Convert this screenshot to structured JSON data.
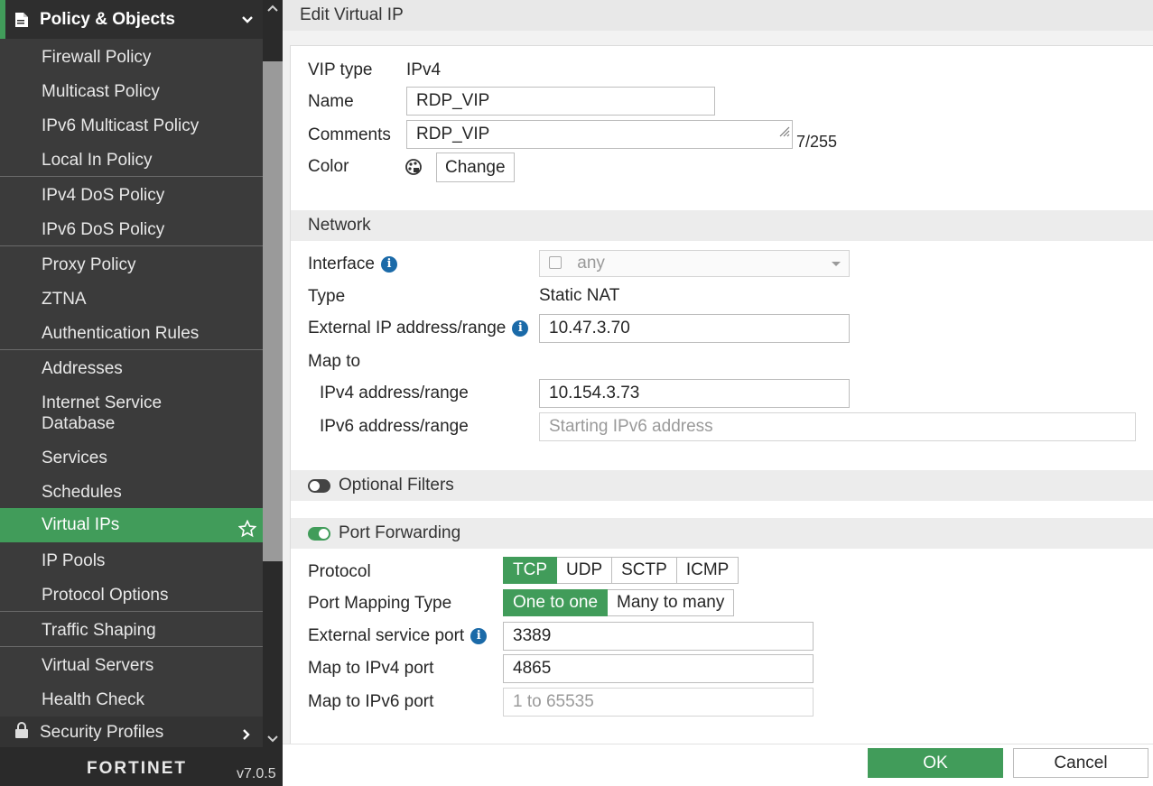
{
  "sidebar": {
    "section_title": "Policy & Objects",
    "items": [
      {
        "label": "Firewall Policy"
      },
      {
        "label": "Multicast Policy"
      },
      {
        "label": "IPv6 Multicast Policy"
      },
      {
        "label": "Local In Policy"
      },
      {
        "label": "IPv4 DoS Policy"
      },
      {
        "label": "IPv6 DoS Policy"
      },
      {
        "label": "Proxy Policy"
      },
      {
        "label": "ZTNA"
      },
      {
        "label": "Authentication Rules"
      },
      {
        "label": "Addresses"
      },
      {
        "label": "Internet Service\nDatabase"
      },
      {
        "label": "Services"
      },
      {
        "label": "Schedules"
      },
      {
        "label": "Virtual IPs"
      },
      {
        "label": "IP Pools"
      },
      {
        "label": "Protocol Options"
      },
      {
        "label": "Traffic Shaping"
      },
      {
        "label": "Virtual Servers"
      },
      {
        "label": "Health Check"
      }
    ],
    "active_item": "Virtual IPs",
    "next_section": "Security Profiles",
    "logo_text": "FORTINET",
    "version": "v7.0.5"
  },
  "page": {
    "title": "Edit Virtual IP"
  },
  "form": {
    "vip_type_label": "VIP type",
    "vip_type_value": "IPv4",
    "name_label": "Name",
    "name_value": "RDP_VIP",
    "comments_label": "Comments",
    "comments_value": "RDP_VIP",
    "comments_counter": "7/255",
    "color_label": "Color",
    "change_label": "Change"
  },
  "network": {
    "heading": "Network",
    "interface_label": "Interface",
    "interface_value": "any",
    "type_label": "Type",
    "type_value": "Static NAT",
    "external_ip_label": "External IP address/range",
    "external_ip_value": "10.47.3.70",
    "map_to_label": "Map to",
    "ipv4_label": "IPv4 address/range",
    "ipv4_value": "10.154.3.73",
    "ipv6_label": "IPv6 address/range",
    "ipv6_placeholder": "Starting IPv6 address"
  },
  "optional_filters": {
    "label": "Optional Filters",
    "enabled": false
  },
  "port_forwarding": {
    "label": "Port Forwarding",
    "enabled": true,
    "protocol_label": "Protocol",
    "protocols": [
      "TCP",
      "UDP",
      "SCTP",
      "ICMP"
    ],
    "protocol_selected": "TCP",
    "mapping_type_label": "Port Mapping Type",
    "mapping_types": [
      "One to one",
      "Many to many"
    ],
    "mapping_selected": "One to one",
    "external_port_label": "External service port",
    "external_port_value": "3389",
    "map_ipv4_port_label": "Map to IPv4 port",
    "map_ipv4_port_value": "4865",
    "map_ipv6_port_label": "Map to IPv6 port",
    "map_ipv6_port_placeholder": "1 to 65535"
  },
  "actions": {
    "ok": "OK",
    "cancel": "Cancel"
  },
  "colors": {
    "accent": "#419c5a",
    "sidebar_bg": "#3b3b3b",
    "info_icon": "#1b6aa8"
  }
}
